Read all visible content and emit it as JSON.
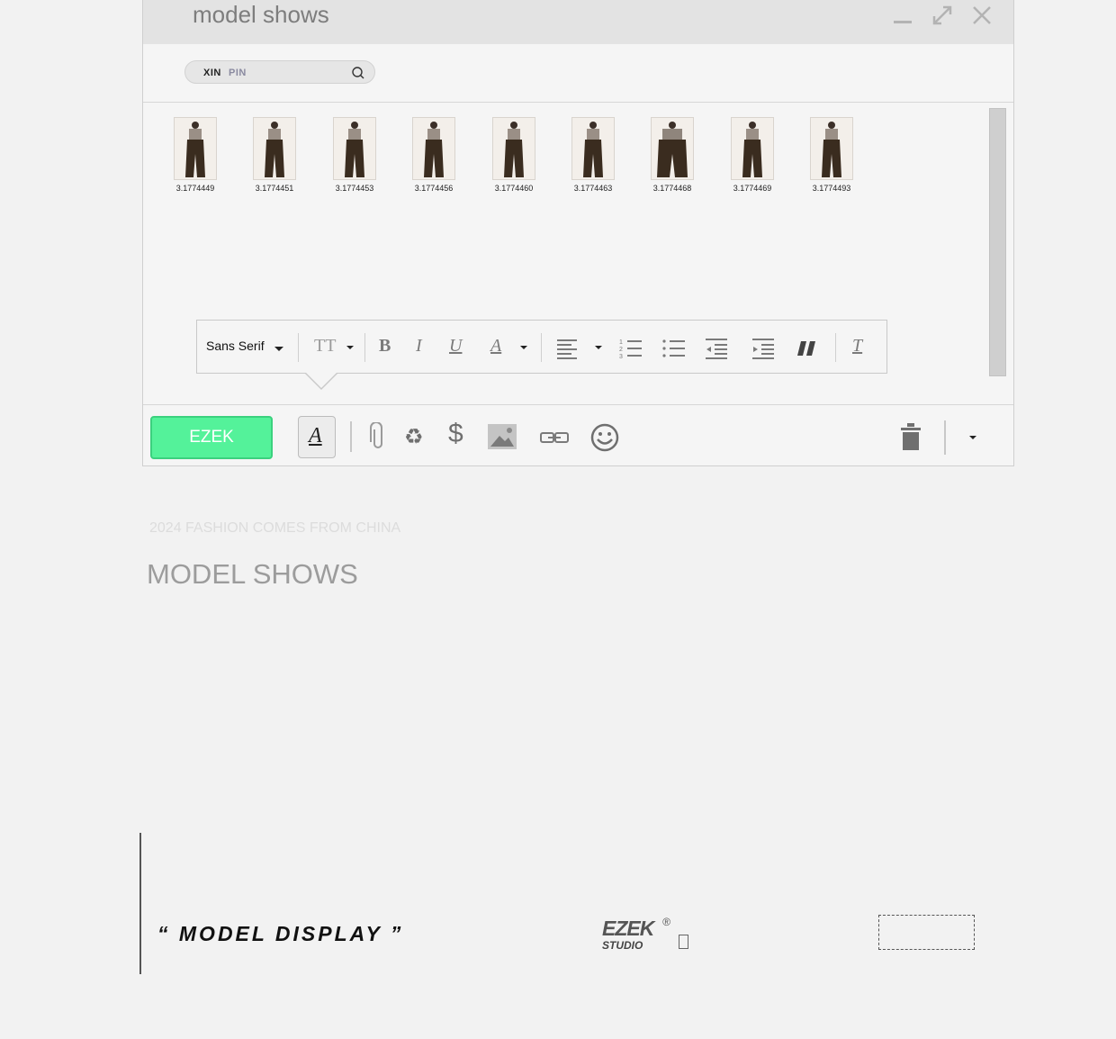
{
  "window": {
    "title": "model shows",
    "controls": [
      "minimize-icon",
      "maximize-icon",
      "close-icon"
    ]
  },
  "search": {
    "part1": "XIN",
    "part2": "PIN",
    "icon": "search-icon"
  },
  "thumbnails": [
    {
      "caption": "3.1774449"
    },
    {
      "caption": "3.1774451"
    },
    {
      "caption": "3.1774453"
    },
    {
      "caption": "3.1774456"
    },
    {
      "caption": "3.1774460"
    },
    {
      "caption": "3.1774463"
    },
    {
      "caption": "3.1774468"
    },
    {
      "caption": "3.1774469"
    },
    {
      "caption": "3.1774493"
    }
  ],
  "format_toolbar": {
    "font": "Sans Serif",
    "size_label": "TT",
    "bold": "B",
    "italic": "I",
    "underline": "U",
    "color": "A",
    "clear": "T"
  },
  "bottom_toolbar": {
    "send_label": "EZEK",
    "format_button": "A",
    "dollar": "$"
  },
  "section": {
    "subtitle": "2024 FASHION COMES FROM CHINA",
    "title": "MODEL SHOWS"
  },
  "footer": {
    "display_text": "“ MODEL DISPLAY ”",
    "brand_main": "EZEK",
    "brand_reg": "®",
    "brand_sub": "STUDIO"
  },
  "colors": {
    "send_button": "#54f29a",
    "background": "#f2f2f2"
  }
}
